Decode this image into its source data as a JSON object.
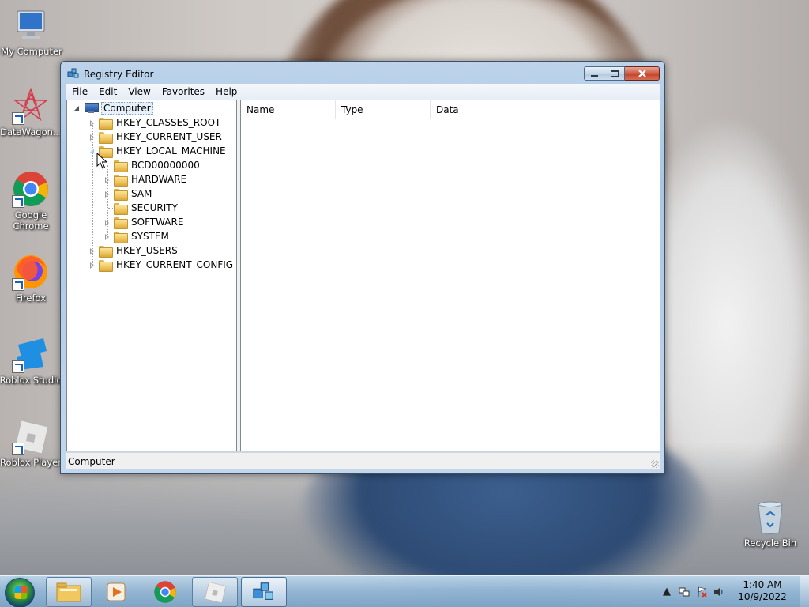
{
  "desktop": {
    "icons": [
      {
        "label": "My Computer"
      },
      {
        "label": "DataWagon..."
      },
      {
        "label": "Google Chrome"
      },
      {
        "label": "Firefox"
      },
      {
        "label": "Roblox Studio"
      },
      {
        "label": "Roblox Player"
      },
      {
        "label": "Recycle Bin"
      }
    ]
  },
  "window": {
    "title": "Registry Editor",
    "menu": [
      "File",
      "Edit",
      "View",
      "Favorites",
      "Help"
    ],
    "tree": {
      "root": "Computer",
      "hives": [
        {
          "label": "HKEY_CLASSES_ROOT",
          "expanded": false
        },
        {
          "label": "HKEY_CURRENT_USER",
          "expanded": false
        },
        {
          "label": "HKEY_LOCAL_MACHINE",
          "expanded": true,
          "children": [
            {
              "label": "BCD00000000",
              "has_children": false
            },
            {
              "label": "HARDWARE",
              "has_children": true
            },
            {
              "label": "SAM",
              "has_children": true
            },
            {
              "label": "SECURITY",
              "has_children": false
            },
            {
              "label": "SOFTWARE",
              "has_children": true
            },
            {
              "label": "SYSTEM",
              "has_children": true
            }
          ]
        },
        {
          "label": "HKEY_USERS",
          "expanded": false
        },
        {
          "label": "HKEY_CURRENT_CONFIG",
          "expanded": false
        }
      ]
    },
    "columns": [
      "Name",
      "Type",
      "Data"
    ],
    "status": "Computer"
  },
  "taskbar": {
    "apps": [
      "start",
      "windows-explorer",
      "media-player",
      "google-chrome",
      "roblox",
      "registry-editor"
    ],
    "clock_time": "1:40 AM",
    "clock_date": "10/9/2022"
  },
  "colors": {
    "window_frame": "#a9c6e4",
    "close_button": "#c3432a",
    "selection_border": "#7da2ce"
  }
}
